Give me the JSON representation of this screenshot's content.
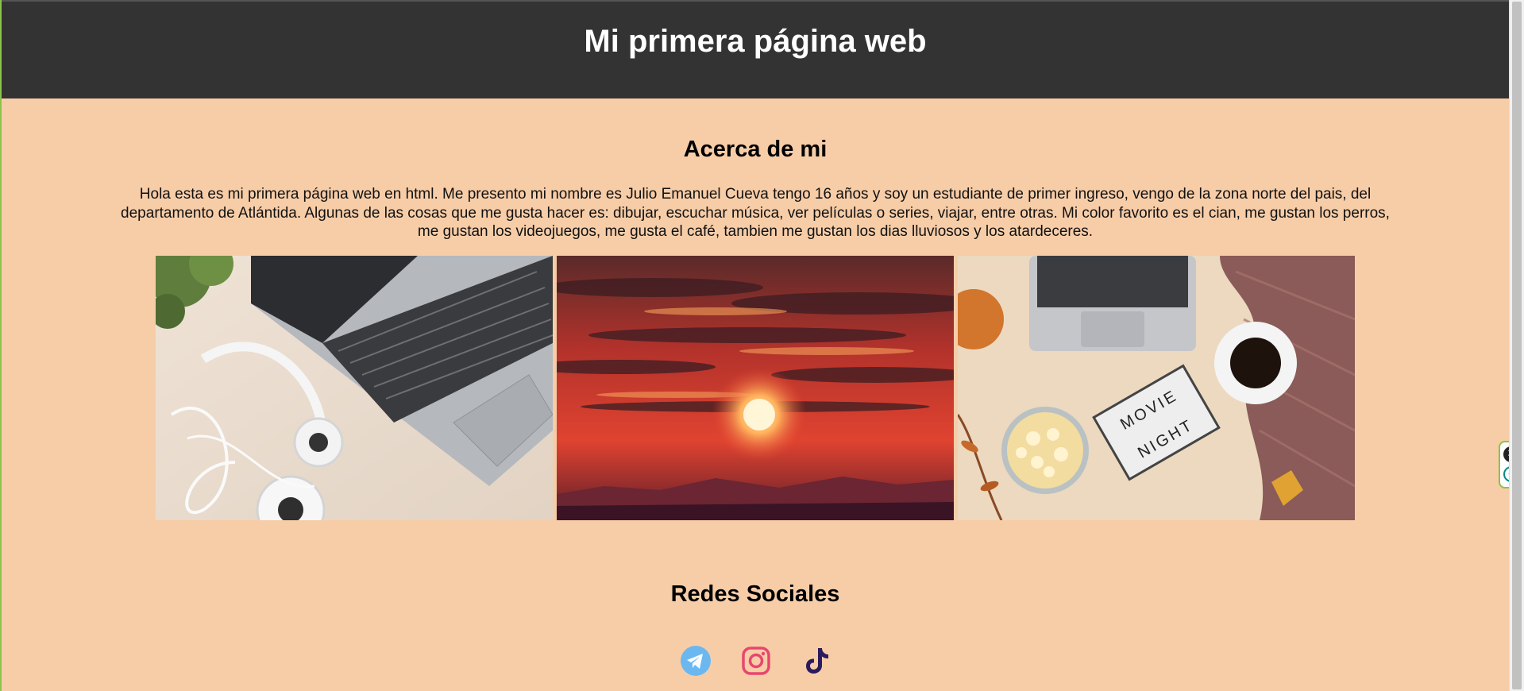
{
  "header": {
    "title": "Mi primera página web"
  },
  "about": {
    "title": "Acerca de mi",
    "text": "Hola esta es mi primera página web en html. Me presento mi nombre es Julio Emanuel Cueva tengo 16 años y soy un estudiante de primer ingreso, vengo de la zona norte del pais, del departamento de Atlántida. Algunas de las cosas que me gusta hacer es: dibujar, escuchar música, ver películas o series, viajar, entre otras. Mi color favorito es el cian, me gustan los perros, me gustan los videojuegos, me gusta el café, tambien me gustan los dias lluviosos y los atardeceres."
  },
  "gallery": {
    "images": [
      {
        "icon": "laptop-headphones-photo"
      },
      {
        "icon": "sunset-photo"
      },
      {
        "icon": "movie-night-photo",
        "sign_text_1": "MOVIE",
        "sign_text_2": "NIGHT"
      }
    ]
  },
  "social": {
    "title": "Redes Sociales",
    "links": [
      {
        "icon": "telegram-icon",
        "color": "#6bb8f0"
      },
      {
        "icon": "instagram-icon",
        "color": "#e8466e"
      },
      {
        "icon": "tiktok-icon",
        "color": "#2b1b5e"
      }
    ]
  },
  "colors": {
    "background": "#f7cda8",
    "header": "#333333"
  }
}
